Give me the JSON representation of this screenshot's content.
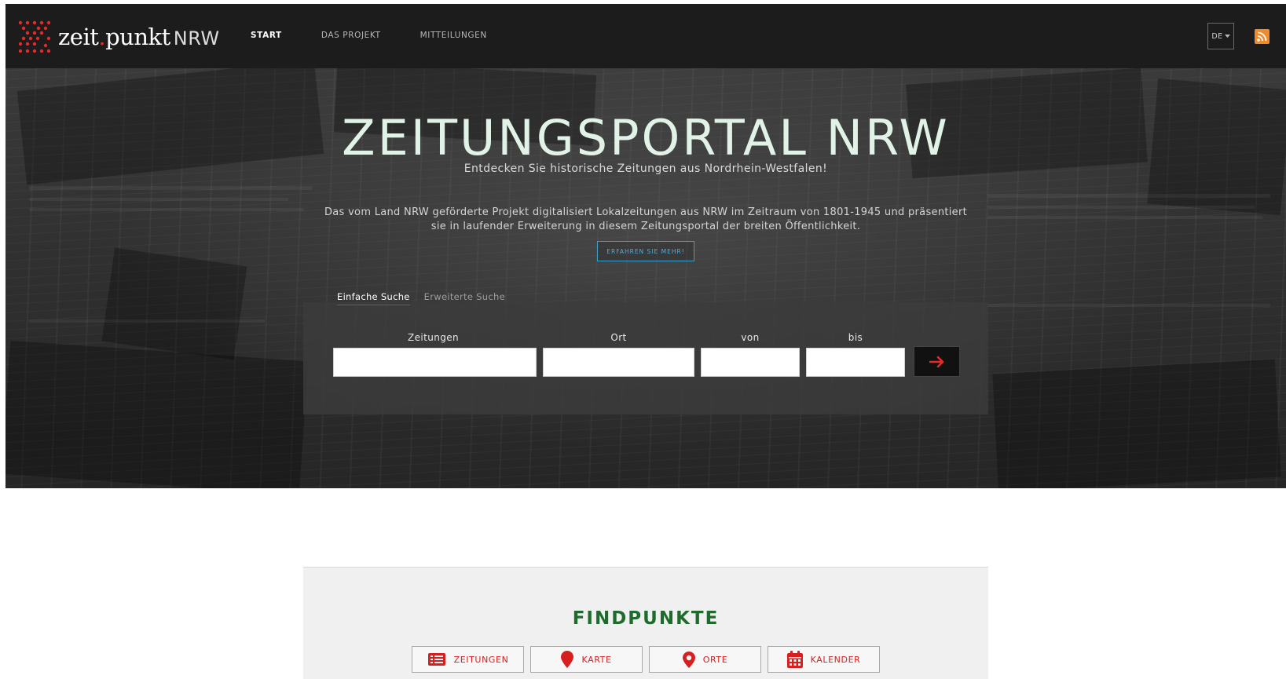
{
  "brand": {
    "name_part1": "zeit",
    "name_dot": ".",
    "name_part2": "punkt",
    "name_suffix": "NRW",
    "accent": "#e52a2a"
  },
  "nav": [
    {
      "label": "START",
      "active": true
    },
    {
      "label": "DAS PROJEKT",
      "active": false
    },
    {
      "label": "MITTEILUNGEN",
      "active": false
    }
  ],
  "lang": {
    "label": "DE",
    "icon": "caret-down-icon"
  },
  "rss": {
    "icon": "rss-icon",
    "color": "#f08a2a"
  },
  "hero": {
    "title": "ZEITUNGSPORTAL NRW",
    "subtitle": "Entdecken Sie historische Zeitungen aus Nordrhein-Westfalen!",
    "description": "Das vom Land NRW geförderte Projekt digitalisiert Lokalzeitungen aus NRW im Zeitraum von 1801-1945 und präsentiert sie in laufender Erweiterung in diesem Zeitungsportal der breiten Öffentlichkeit.",
    "more_button": "ERFAHREN SIE MEHR!"
  },
  "search": {
    "tabs": [
      {
        "label": "Einfache Suche",
        "active": true
      },
      {
        "label": "Erweiterte Suche",
        "active": false
      }
    ],
    "fields": {
      "zeitungen": {
        "label": "Zeitungen",
        "value": ""
      },
      "ort": {
        "label": "Ort",
        "value": ""
      },
      "von": {
        "label": "von",
        "value": ""
      },
      "bis": {
        "label": "bis",
        "value": ""
      }
    },
    "submit_icon": "arrow-right-icon"
  },
  "findpunkte": {
    "title": "FINDPUNKTE",
    "buttons": [
      {
        "label": "ZEITUNGEN",
        "icon": "newspaper-list-icon"
      },
      {
        "label": "KARTE",
        "icon": "map-marker-icon"
      },
      {
        "label": "ORTE",
        "icon": "location-pin-icon"
      },
      {
        "label": "KALENDER",
        "icon": "calendar-icon"
      }
    ],
    "title_color": "#1f6b2e",
    "button_color": "#d71f1f"
  }
}
